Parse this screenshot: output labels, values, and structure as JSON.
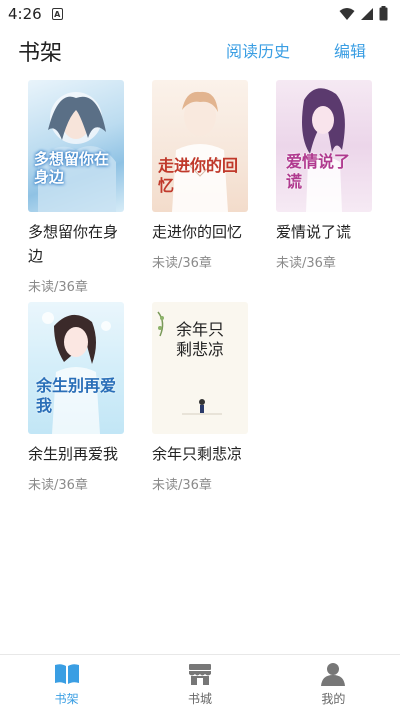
{
  "status": {
    "time": "4:26",
    "notification_letter": "A"
  },
  "header": {
    "title": "书架",
    "history": "阅读历史",
    "edit": "编辑"
  },
  "books": [
    {
      "title": "多想留你在身边",
      "status": "未读/36章",
      "cover_text": "多想留你在身边"
    },
    {
      "title": "走进你的回忆",
      "status": "未读/36章",
      "cover_text": "走进你的回忆"
    },
    {
      "title": "爱情说了谎",
      "status": "未读/36章",
      "cover_text": "爱情说了谎"
    },
    {
      "title": "余生别再爱我",
      "status": "未读/36章",
      "cover_text": "余生别再爱我"
    },
    {
      "title": "余年只剩悲凉",
      "status": "未读/36章",
      "cover_text": "余年只剩悲凉"
    }
  ],
  "tabs": [
    {
      "label": "书架",
      "icon": "book-icon",
      "active": true
    },
    {
      "label": "书城",
      "icon": "store-icon",
      "active": false
    },
    {
      "label": "我的",
      "icon": "person-icon",
      "active": false
    }
  ],
  "colors": {
    "accent": "#3a9ee3",
    "muted": "#8a8a8a"
  }
}
